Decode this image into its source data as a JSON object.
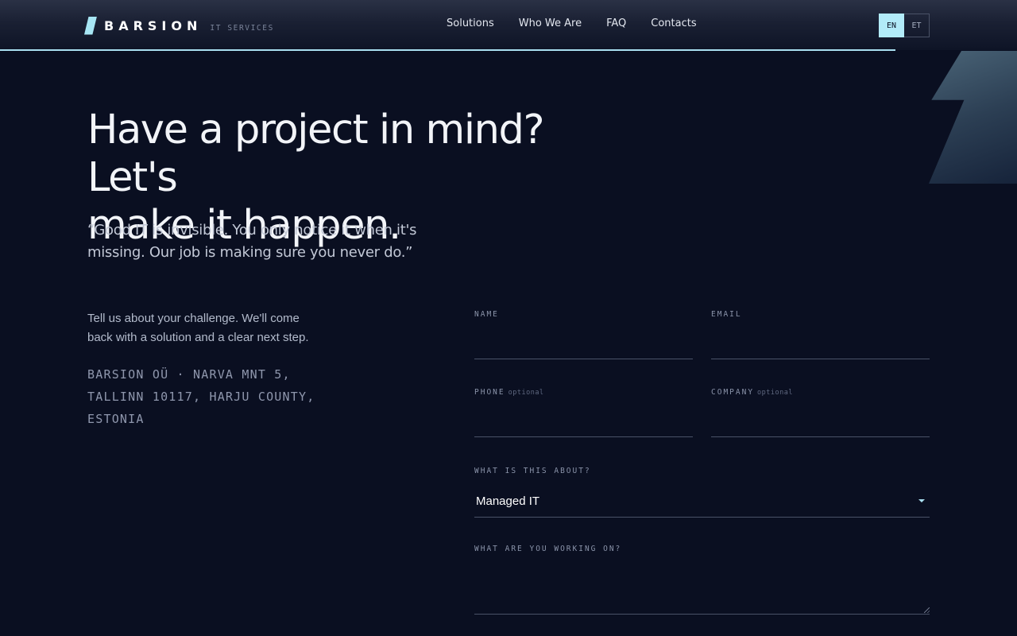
{
  "header": {
    "brand": "BARSION",
    "tagline": "IT SERVICES",
    "nav": [
      "Solutions",
      "Who We Are",
      "FAQ",
      "Contacts"
    ],
    "languages": [
      {
        "code": "EN",
        "active": true
      },
      {
        "code": "ET",
        "active": false
      }
    ]
  },
  "hero": {
    "headline_line1": "Have a project in mind? Let's",
    "headline_line2": "make it happen.",
    "quote_line1": "“Good IT is invisible. You only notice it when it's",
    "quote_line2": "missing. Our job is making sure you never do.”"
  },
  "info": {
    "intro_line1": "Tell us about your challenge. We'll come",
    "intro_line2": "back with a solution and a clear next step.",
    "address_line1": "BARSION OÜ · NARVA MNT 5,",
    "address_line2": "TALLINN 10117, HARJU COUNTY,",
    "address_line3": "ESTONIA"
  },
  "form": {
    "name_label": "NAME",
    "email_label": "EMAIL",
    "phone_label": "PHONE",
    "company_label": "COMPANY",
    "optional_tag": "optional",
    "topic_label": "WHAT IS THIS ABOUT?",
    "topic_value": "Managed IT",
    "message_label": "WHAT ARE YOU WORKING ON?"
  },
  "colors": {
    "background": "#0a0f21",
    "accent": "#a9dff0",
    "lang_active_bg": "#b2ebf8"
  },
  "icons": [
    "logo-mark-icon",
    "chevron-down-icon",
    "resize-handle-icon"
  ]
}
